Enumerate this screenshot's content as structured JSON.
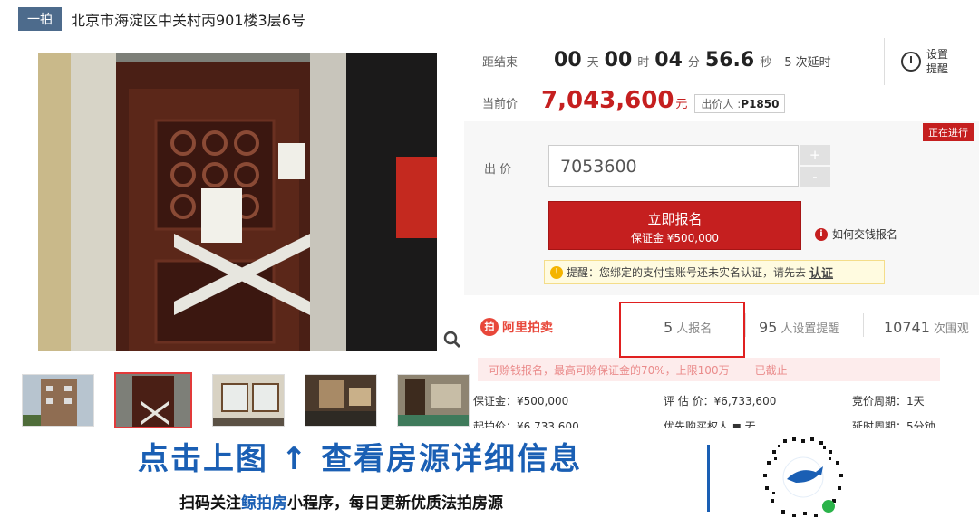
{
  "title_bar": {
    "badge": "一拍",
    "title": "北京市海淀区中关村丙901楼3层6号"
  },
  "countdown": {
    "label": "距结束",
    "days": "00",
    "days_unit": "天",
    "hours": "00",
    "hours_unit": "时",
    "minutes": "04",
    "minutes_unit": "分",
    "seconds": "56.6",
    "seconds_unit": "秒",
    "extensions": "5 次延时"
  },
  "reminder": {
    "line1": "设置",
    "line2": "提醒"
  },
  "current_price": {
    "label": "当前价",
    "value": "7,043,600",
    "unit": "元",
    "bidder_label": "出价人 :",
    "bidder_id": "P1850"
  },
  "status": "正在进行",
  "bid": {
    "label": "出 价",
    "value": "7053600",
    "plus": "+",
    "minus": "-"
  },
  "signup": {
    "label": "立即报名",
    "deposit": "保证金 ¥500,000"
  },
  "howto": {
    "icon": "i",
    "label": "如何交钱报名"
  },
  "notice": {
    "text": "提醒：您绑定的支付宝账号还未实名认证，请先去",
    "link": "认证"
  },
  "stats": {
    "brand": "阿里拍卖",
    "signups": "5",
    "signups_label": "人报名",
    "reminders": "95",
    "reminders_label": "人设置提醒",
    "views": "10741",
    "views_label": "次围观"
  },
  "refund_bar": {
    "text": "可赊钱报名，最高可赊保证金的70%，上限100万",
    "status": "已截止"
  },
  "info": {
    "deposit": "保证金：¥500,000",
    "appraisal": "评 估 价：¥6,733,600",
    "cycle": "竞价周期：1天",
    "start_price": "起拍价：¥6,733,600",
    "priority": "优先购买权人 ◼ 无",
    "delay": "延时周期：5分钟"
  },
  "banner": {
    "title": "点击上图 ↑ 查看房源详细信息",
    "sub_prefix": "扫码关注",
    "sub_highlight": "鲸拍房",
    "sub_suffix": "小程序，每日更新优质法拍房源"
  },
  "colors": {
    "accent_red": "#c51f1f",
    "brand_blue": "#1a5fb4"
  }
}
